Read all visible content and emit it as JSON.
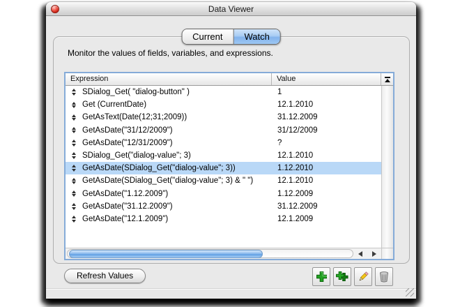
{
  "window": {
    "title": "Data Viewer"
  },
  "tabs": [
    {
      "label": "Current",
      "selected": false
    },
    {
      "label": "Watch",
      "selected": true
    }
  ],
  "description": "Monitor the values of fields, variables, and expressions.",
  "table": {
    "columns": [
      "Expression",
      "Value"
    ],
    "rows": [
      {
        "expression": "SDialog_Get( \"dialog-button\" )",
        "value": "1",
        "selected": false
      },
      {
        "expression": "Get (CurrentDate)",
        "value": "12.1.2010",
        "selected": false
      },
      {
        "expression": "GetAsText(Date(12;31;2009))",
        "value": "31.12.2009",
        "selected": false
      },
      {
        "expression": "GetAsDate(\"31/12/2009\")",
        "value": "31/12/2009",
        "selected": false
      },
      {
        "expression": "GetAsDate(\"12/31/2009\")",
        "value": "?",
        "selected": false
      },
      {
        "expression": "SDialog_Get(\"dialog-value\"; 3)",
        "value": "12.1.2010",
        "selected": false
      },
      {
        "expression": "GetAsDate(SDialog_Get(\"dialog-value\"; 3))",
        "value": "1.12.2010",
        "selected": true
      },
      {
        "expression": "GetAsDate(SDialog_Get(\"dialog-value\"; 3) & \" \")",
        "value": "12.1.2010",
        "selected": false
      },
      {
        "expression": "GetAsDate(\"1.12.2009\")",
        "value": "1.12.2009",
        "selected": false
      },
      {
        "expression": "GetAsDate(\"31.12.2009\")",
        "value": "31.12.2009",
        "selected": false
      },
      {
        "expression": "GetAsDate(\"12.1.2009\")",
        "value": "12.1.2009",
        "selected": false
      }
    ]
  },
  "footer": {
    "refresh_label": "Refresh Values",
    "icon_buttons": [
      {
        "name": "add-expression",
        "icon": "plus"
      },
      {
        "name": "add-multiple-expressions",
        "icon": "double-plus"
      },
      {
        "name": "edit-expression",
        "icon": "pencil"
      },
      {
        "name": "delete-expression",
        "icon": "trash"
      }
    ]
  },
  "colors": {
    "selection": "#b9d8f7",
    "tab_selected": "#82b3ec",
    "focus_ring": "#85abd8",
    "plus_green": "#1f9e1f",
    "window_bg": "#e9e9e9"
  }
}
